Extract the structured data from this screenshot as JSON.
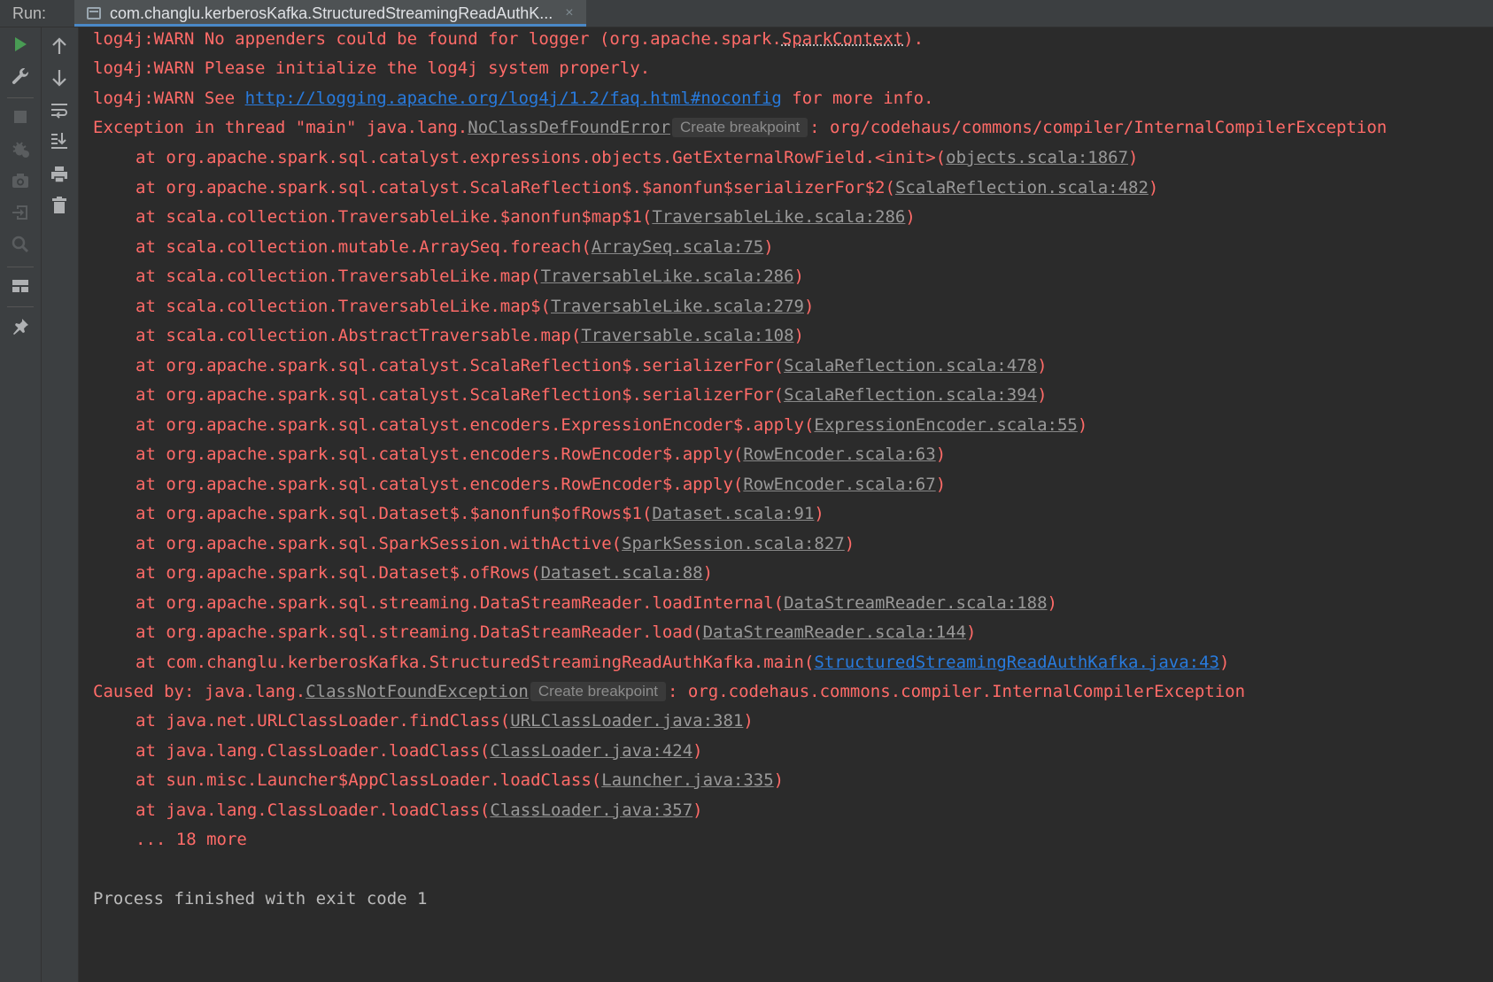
{
  "tabbar": {
    "run_label": "Run:",
    "tab_title": "com.changlu.kerberosKafka.StructuredStreamingReadAuthK...",
    "close_glyph": "×"
  },
  "toolbar": {
    "left": [
      "run-icon",
      "wrench-icon",
      "stop-icon",
      "debug-icon",
      "camera-icon",
      "exit-icon",
      "search-settings-icon",
      "layout-icon",
      "pin-icon"
    ],
    "right": [
      "arrow-up-icon",
      "arrow-down-icon",
      "soft-wrap-icon",
      "scroll-to-end-icon",
      "print-icon",
      "trash-icon"
    ]
  },
  "console": {
    "warn1": {
      "pre": "log4j:WARN No appenders could be found for logger (org.apache.spark.",
      "cls": "SparkContext",
      "post": ")."
    },
    "warn2": "log4j:WARN Please initialize the log4j system properly.",
    "warn3": {
      "pre": "log4j:WARN See ",
      "url": "http://logging.apache.org/log4j/1.2/faq.html#noconfig",
      "post": " for more info."
    },
    "exception": {
      "pre": "Exception in thread \"main\" java.lang.",
      "cls": "NoClassDefFoundError",
      "bp": "Create breakpoint",
      "post": ": org/codehaus/commons/compiler/InternalCompilerException"
    },
    "frames1": [
      {
        "method": "at org.apache.spark.sql.catalyst.expressions.objects.GetExternalRowField.<init>(",
        "loc": "objects.scala:1867"
      },
      {
        "method": "at org.apache.spark.sql.catalyst.ScalaReflection$.$anonfun$serializerFor$2(",
        "loc": "ScalaReflection.scala:482"
      },
      {
        "method": "at scala.collection.TraversableLike.$anonfun$map$1(",
        "loc": "TraversableLike.scala:286"
      },
      {
        "method": "at scala.collection.mutable.ArraySeq.foreach(",
        "loc": "ArraySeq.scala:75"
      },
      {
        "method": "at scala.collection.TraversableLike.map(",
        "loc": "TraversableLike.scala:286"
      },
      {
        "method": "at scala.collection.TraversableLike.map$(",
        "loc": "TraversableLike.scala:279"
      },
      {
        "method": "at scala.collection.AbstractTraversable.map(",
        "loc": "Traversable.scala:108"
      },
      {
        "method": "at org.apache.spark.sql.catalyst.ScalaReflection$.serializerFor(",
        "loc": "ScalaReflection.scala:478"
      },
      {
        "method": "at org.apache.spark.sql.catalyst.ScalaReflection$.serializerFor(",
        "loc": "ScalaReflection.scala:394"
      },
      {
        "method": "at org.apache.spark.sql.catalyst.encoders.ExpressionEncoder$.apply(",
        "loc": "ExpressionEncoder.scala:55"
      },
      {
        "method": "at org.apache.spark.sql.catalyst.encoders.RowEncoder$.apply(",
        "loc": "RowEncoder.scala:63"
      },
      {
        "method": "at org.apache.spark.sql.catalyst.encoders.RowEncoder$.apply(",
        "loc": "RowEncoder.scala:67"
      },
      {
        "method": "at org.apache.spark.sql.Dataset$.$anonfun$ofRows$1(",
        "loc": "Dataset.scala:91"
      },
      {
        "method": "at org.apache.spark.sql.SparkSession.withActive(",
        "loc": "SparkSession.scala:827"
      },
      {
        "method": "at org.apache.spark.sql.Dataset$.ofRows(",
        "loc": "Dataset.scala:88"
      },
      {
        "method": "at org.apache.spark.sql.streaming.DataStreamReader.loadInternal(",
        "loc": "DataStreamReader.scala:188"
      },
      {
        "method": "at org.apache.spark.sql.streaming.DataStreamReader.load(",
        "loc": "DataStreamReader.scala:144"
      },
      {
        "method": "at com.changlu.kerberosKafka.StructuredStreamingReadAuthKafka.main(",
        "loc": "StructuredStreamingReadAuthKafka.java:43"
      }
    ],
    "caused": {
      "pre": "Caused by: java.lang.",
      "cls": "ClassNotFoundException",
      "bp": "Create breakpoint",
      "post": ": org.codehaus.commons.compiler.InternalCompilerException"
    },
    "frames2": [
      {
        "method": "at java.net.URLClassLoader.findClass(",
        "loc": "URLClassLoader.java:381"
      },
      {
        "method": "at java.lang.ClassLoader.loadClass(",
        "loc": "ClassLoader.java:424"
      },
      {
        "method": "at sun.misc.Launcher$AppClassLoader.loadClass(",
        "loc": "Launcher.java:335"
      },
      {
        "method": "at java.lang.ClassLoader.loadClass(",
        "loc": "ClassLoader.java:357"
      }
    ],
    "more": "... 18 more",
    "finished": "Process finished with exit code 1"
  },
  "colors": {
    "error_text": "#ff6b68",
    "link_gray": "#999999",
    "link_blue": "#287bde",
    "background": "#2b2b2b",
    "run_green": "#499c54"
  }
}
